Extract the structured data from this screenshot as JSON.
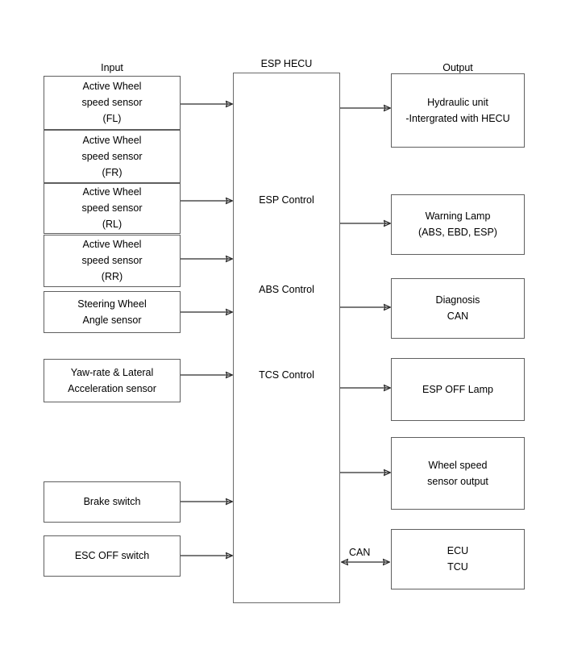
{
  "headers": {
    "input": "Input",
    "hecu": "ESP HECU",
    "output": "Output"
  },
  "input_boxes": [
    {
      "id": "wheel-speed-fl",
      "lines": [
        "Active Wheel",
        "speed sensor",
        "(FL)"
      ]
    },
    {
      "id": "wheel-speed-fr",
      "lines": [
        "Active Wheel",
        "speed sensor",
        "(FR)"
      ]
    },
    {
      "id": "wheel-speed-rl",
      "lines": [
        "Active Wheel",
        "speed sensor",
        "(RL)"
      ]
    },
    {
      "id": "wheel-speed-rr",
      "lines": [
        "Active Wheel",
        "speed sensor",
        "(RR)"
      ]
    },
    {
      "id": "steering-angle-sensor",
      "lines": [
        "Steering Wheel",
        "Angle sensor"
      ]
    },
    {
      "id": "yaw-rate-lateral-sensor",
      "lines": [
        "Yaw-rate & Lateral",
        "Acceleration sensor"
      ]
    },
    {
      "id": "brake-switch",
      "lines": [
        "Brake switch"
      ]
    },
    {
      "id": "esc-off-switch",
      "lines": [
        "ESC OFF switch"
      ]
    }
  ],
  "hecu_functions": [
    {
      "id": "esp-control",
      "label": "ESP Control"
    },
    {
      "id": "abs-control",
      "label": "ABS Control"
    },
    {
      "id": "tcs-control",
      "label": "TCS Control"
    }
  ],
  "output_boxes": [
    {
      "id": "hydraulic-unit",
      "lines": [
        "Hydraulic unit",
        "-Intergrated with HECU"
      ]
    },
    {
      "id": "warning-lamp",
      "lines": [
        "Warning Lamp",
        "(ABS, EBD, ESP)"
      ]
    },
    {
      "id": "diagnosis-can",
      "lines": [
        "Diagnosis",
        "CAN"
      ]
    },
    {
      "id": "esp-off-lamp",
      "lines": [
        "ESP OFF Lamp"
      ]
    },
    {
      "id": "wheel-speed-sensor-output",
      "lines": [
        "Wheel speed",
        "sensor output"
      ]
    },
    {
      "id": "ecu-tcu",
      "lines": [
        "ECU",
        "TCU"
      ]
    }
  ],
  "connection_labels": {
    "can": "CAN"
  },
  "colors": {
    "box_border": "#5f5f5f",
    "line": "#2b2b2b",
    "background": "#ffffff",
    "text": "#000000"
  }
}
